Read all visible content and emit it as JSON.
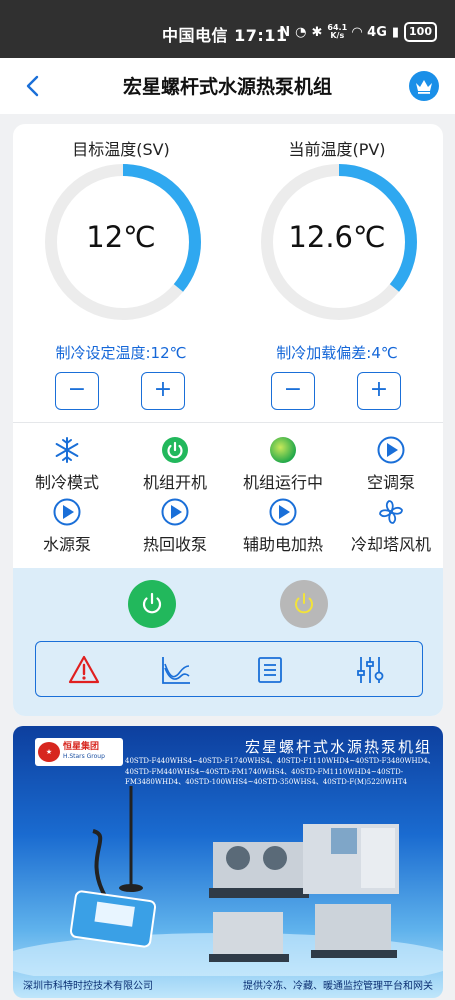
{
  "status_bar": {
    "carrier_time": "中国电信 17:11",
    "net_speed_top": "64.1",
    "net_speed_bottom": "K/s",
    "network": "4G",
    "battery": "100"
  },
  "header": {
    "title": "宏星螺杆式水源热泵机组"
  },
  "gauges": {
    "target": {
      "label": "目标温度(SV)",
      "value": "12℃",
      "setting": "制冷设定温度:12℃",
      "fill_fraction": 0.36
    },
    "current": {
      "label": "当前温度(PV)",
      "value": "12.6℃",
      "setting": "制冷加载偏差:4℃",
      "fill_fraction": 0.36
    },
    "minus_label": "−",
    "plus_label": "+"
  },
  "status_items": [
    {
      "icon": "snowflake-icon",
      "label": "制冷模式"
    },
    {
      "icon": "power-on-icon",
      "label": "机组开机"
    },
    {
      "icon": "running-light-icon",
      "label": "机组运行中"
    },
    {
      "icon": "play-icon",
      "label": "空调泵"
    },
    {
      "icon": "play-icon",
      "label": "水源泵"
    },
    {
      "icon": "play-icon",
      "label": "热回收泵"
    },
    {
      "icon": "play-icon",
      "label": "辅助电加热"
    },
    {
      "icon": "fan-icon",
      "label": "冷却塔风机"
    }
  ],
  "controls": {
    "tools": [
      "alarm-icon",
      "trend-chart-icon",
      "list-icon",
      "settings-sliders-icon"
    ]
  },
  "banner": {
    "logo_cn": "恒星集团",
    "logo_en": "H.Stars Group",
    "title": "宏星螺杆式水源热泵机组",
    "models": "40STD-F440WHS4~40STD-F1740WHS4、40STD-F1110WHD4~40STD-F3480WHD4、40STD-FM440WHS4~40STD-FM1740WHS4、40STD-FM1110WHD4~40STD-FM3480WHD4、40STD-100WHS4~40STD-350WHS4、40STD-F(M)5220WHT4",
    "footer_left": "深圳市科特时控技术有限公司",
    "footer_right": "提供冷冻、冷藏、暖通监控管理平台和网关"
  },
  "colors": {
    "accent_blue": "#1a6fd8",
    "gauge_blue": "#2fa8f0",
    "power_green": "#22b85c",
    "panel_bg": "#dcedf9"
  }
}
